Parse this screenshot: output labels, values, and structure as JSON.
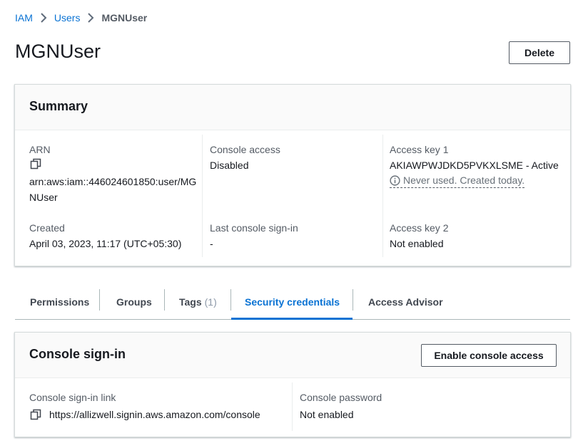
{
  "breadcrumb": {
    "items": [
      "IAM",
      "Users"
    ],
    "current": "MGNUser"
  },
  "page": {
    "title": "MGNUser",
    "delete_label": "Delete"
  },
  "summary": {
    "title": "Summary",
    "arn_label": "ARN",
    "arn_value": "arn:aws:iam::446024601850:user/MGNUser",
    "console_access_label": "Console access",
    "console_access_value": "Disabled",
    "access_key1_label": "Access key 1",
    "access_key1_value": "AKIAWPWJDKD5PVKXLSME - Active",
    "access_key1_hint": "Never used. Created today.",
    "created_label": "Created",
    "created_value": "April 03, 2023, 11:17 (UTC+05:30)",
    "last_signin_label": "Last console sign-in",
    "last_signin_value": "-",
    "access_key2_label": "Access key 2",
    "access_key2_value": "Not enabled"
  },
  "tabs": {
    "permissions": "Permissions",
    "groups": "Groups",
    "tags": "Tags",
    "tags_count": "(1)",
    "security_credentials": "Security credentials",
    "access_advisor": "Access Advisor",
    "active": "Security credentials"
  },
  "console_signin": {
    "title": "Console sign-in",
    "enable_label": "Enable console access",
    "link_label": "Console sign-in link",
    "link_value": "https://allizwell.signin.aws.amazon.com/console",
    "password_label": "Console password",
    "password_value": "Not enabled"
  },
  "colors": {
    "accent": "#0972d3",
    "text": "#16191f",
    "muted": "#545b64",
    "border": "#d5dbdb"
  },
  "icons": [
    "chevron-right-icon",
    "copy-icon",
    "info-icon"
  ]
}
